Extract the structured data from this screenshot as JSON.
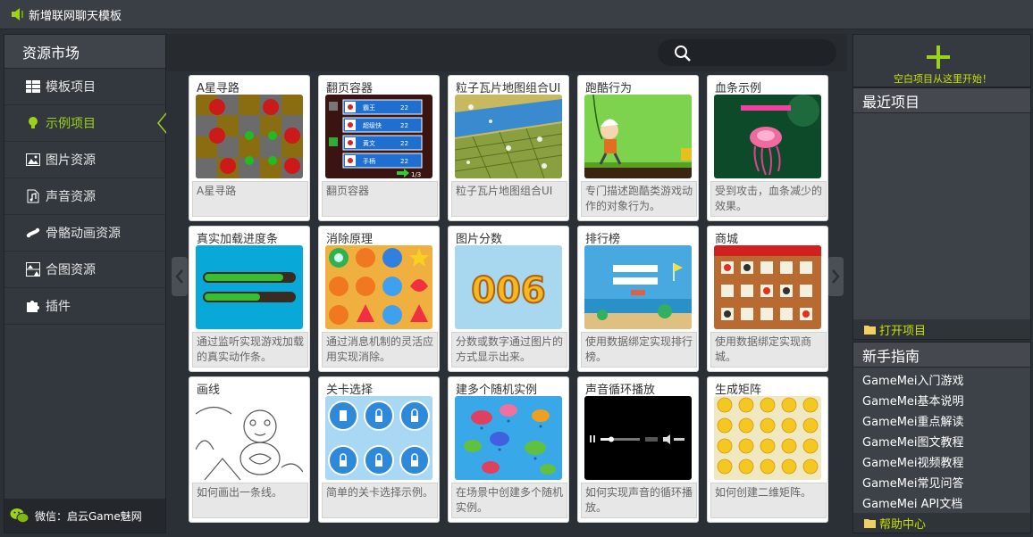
{
  "window": {
    "title": "新增联网聊天模板"
  },
  "sidebar": {
    "header": "资源市场",
    "items": [
      {
        "label": "模板项目",
        "icon": "grid-icon"
      },
      {
        "label": "示例项目",
        "icon": "lightbulb-icon"
      },
      {
        "label": "图片资源",
        "icon": "image-icon"
      },
      {
        "label": "声音资源",
        "icon": "music-file-icon"
      },
      {
        "label": "骨骼动画资源",
        "icon": "bone-icon"
      },
      {
        "label": "合图资源",
        "icon": "atlas-icon"
      },
      {
        "label": "插件",
        "icon": "puzzle-icon"
      }
    ],
    "active_index": 1,
    "wechat": "微信：启云Game魅网"
  },
  "cards": [
    {
      "title": "A星寻路",
      "desc": "A星寻路"
    },
    {
      "title": "翻页容器",
      "desc": "翻页容器"
    },
    {
      "title": "粒子瓦片地图组合UI",
      "desc": "粒子瓦片地图组合UI"
    },
    {
      "title": "跑酷行为",
      "desc": "专门描述跑酷类游戏动作的对象行为。"
    },
    {
      "title": "血条示例",
      "desc": "受到攻击，血条减少的效果。"
    },
    {
      "title": "真实加载进度条",
      "desc": "通过监听实现游戏加载的真实动作条。"
    },
    {
      "title": "消除原理",
      "desc": "通过消息机制的灵活应用实现消除。"
    },
    {
      "title": "图片分数",
      "desc": "分数或数字通过图片的方式显示出来。"
    },
    {
      "title": "排行榜",
      "desc": "使用数据绑定实现排行榜。"
    },
    {
      "title": "商城",
      "desc": "使用数据绑定实现商城。"
    },
    {
      "title": "画线",
      "desc": "如何画出一条线。"
    },
    {
      "title": "关卡选择",
      "desc": "简单的关卡选择示例。"
    },
    {
      "title": "建多个随机实例",
      "desc": "在场景中创建多个随机实例。"
    },
    {
      "title": "声音循环播放",
      "desc": "如何实现声音的循环播放。"
    },
    {
      "title": "生成矩阵",
      "desc": "如何创建二维矩阵。"
    }
  ],
  "thumb_text": {
    "score": "006",
    "page": "1/3",
    "scroll_labels": [
      "霸王",
      "超级快",
      "黄文",
      "手柄"
    ],
    "scroll_values": [
      "22",
      "22",
      "22",
      "22"
    ]
  },
  "right": {
    "new_project_text": "空白项目从这里开始！",
    "recent": {
      "title": "最近项目",
      "open": "打开项目"
    },
    "guide": {
      "title": "新手指南",
      "items": [
        "GameMei入门游戏",
        "GameMei基本说明",
        "GameMei重点解读",
        "GameMei图文教程",
        "GameMei视频教程",
        "GameMei常见问答",
        "GameMei API文档"
      ],
      "help": "帮助中心"
    }
  },
  "colors": {
    "accent": "#9ed21a",
    "highlight_text": "#c8e000",
    "background": "#2b3036"
  }
}
